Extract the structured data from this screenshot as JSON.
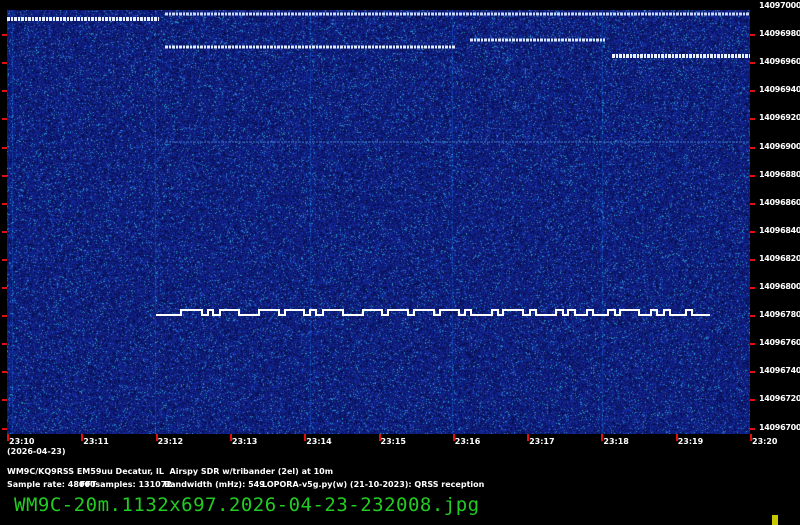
{
  "y_axis": {
    "labels": [
      "14097000",
      "14096980",
      "14096960",
      "14096940",
      "14096920",
      "14096900",
      "14096880",
      "14096860",
      "14096840",
      "14096820",
      "14096800",
      "14096780",
      "14096760",
      "14096740",
      "14096720",
      "14096700"
    ]
  },
  "x_axis": {
    "labels": [
      "23:10",
      "23:11",
      "23:12",
      "23:13",
      "23:14",
      "23:15",
      "23:16",
      "23:17",
      "23:18",
      "23:19",
      "23:20"
    ],
    "date": "(2026-04-23)"
  },
  "info": {
    "station": "WM9C/KQ9RSS EM59uu Decatur, IL  Airspy SDR w/tribander (2el) at 10m",
    "sample_rate": "Sample rate: 48000",
    "fft_samples": "FFTsamples: 131072",
    "bandwidth": "Bandwidth (mHz): 549",
    "software": "LOPORA-v5g.py(w) (21-10-2023): QRSS reception"
  },
  "filename": "WM9C-20m.1132x697.2026-04-23-232008.jpg",
  "colors": {
    "background": "#0b1b63",
    "tick": "#e01010",
    "filename": "#22cc22"
  }
}
